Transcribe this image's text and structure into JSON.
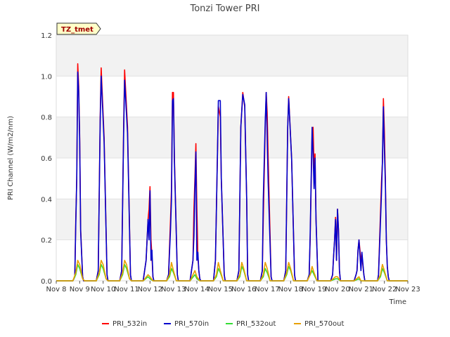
{
  "chart_data": {
    "type": "line",
    "title": "Tonzi Tower PRI",
    "xlabel": "Time",
    "ylabel": "PRI Channel (W/m2/nm)",
    "site_badge": "TZ_tmet",
    "ylim": [
      0,
      1.2
    ],
    "yticks": [
      0.0,
      0.2,
      0.4,
      0.6,
      0.8,
      1.0,
      1.2
    ],
    "ytick_labels": [
      "0.0",
      "0.2",
      "0.4",
      "0.6",
      "0.8",
      "1.0",
      "1.2"
    ],
    "xlim": [
      "2016-11-08",
      "2016-11-23"
    ],
    "xtick_labels": [
      "Nov 8",
      "Nov 9",
      "Nov 10",
      "Nov 11",
      "Nov 12",
      "Nov 13",
      "Nov 14",
      "Nov 15",
      "Nov 16",
      "Nov 17",
      "Nov 18",
      "Nov 19",
      "Nov 20",
      "Nov 21",
      "Nov 22",
      "Nov 23"
    ],
    "grid": "horizontal bands",
    "legend_position": "bottom",
    "series": [
      {
        "name": "PRI_532in",
        "color": "#ff0000",
        "x": [
          "2016-11-08 00:00",
          "2016-11-08 17:00",
          "2016-11-08 19:00",
          "2016-11-08 20:00",
          "2016-11-08 21:00",
          "2016-11-08 22:00",
          "2016-11-08 23:00",
          "2016-11-09 00:00",
          "2016-11-09 01:00",
          "2016-11-09 03:00",
          "2016-11-09 04:00",
          "2016-11-09 05:00",
          "2016-11-09 17:00",
          "2016-11-09 19:00",
          "2016-11-09 21:00",
          "2016-11-09 22:00",
          "2016-11-10 01:00",
          "2016-11-10 04:00",
          "2016-11-10 05:00",
          "2016-11-10 17:00",
          "2016-11-10 19:00",
          "2016-11-10 21:00",
          "2016-11-10 22:00",
          "2016-11-11 01:00",
          "2016-11-11 04:00",
          "2016-11-11 05:00",
          "2016-11-11 17:00",
          "2016-11-11 20:00",
          "2016-11-11 21:00",
          "2016-11-11 22:00",
          "2016-11-11 23:00",
          "2016-11-12 00:00",
          "2016-11-12 01:00",
          "2016-11-12 02:00",
          "2016-11-12 03:00",
          "2016-11-12 04:00",
          "2016-11-12 17:00",
          "2016-11-12 19:00",
          "2016-11-12 21:00",
          "2016-11-12 22:00",
          "2016-11-12 23:00",
          "2016-11-13 00:00",
          "2016-11-13 01:00",
          "2016-11-13 04:00",
          "2016-11-13 05:00",
          "2016-11-13 17:00",
          "2016-11-13 20:00",
          "2016-11-13 21:00",
          "2016-11-13 22:00",
          "2016-11-13 23:00",
          "2016-11-14 00:00",
          "2016-11-14 01:00",
          "2016-11-14 02:00",
          "2016-11-14 03:00",
          "2016-11-14 04:00",
          "2016-11-14 17:00",
          "2016-11-14 19:00",
          "2016-11-14 21:00",
          "2016-11-14 22:00",
          "2016-11-15 00:00",
          "2016-11-15 01:00",
          "2016-11-15 04:00",
          "2016-11-15 05:00",
          "2016-11-15 17:00",
          "2016-11-15 19:00",
          "2016-11-15 21:00",
          "2016-11-15 23:00",
          "2016-11-16 01:00",
          "2016-11-16 03:00",
          "2016-11-16 04:00",
          "2016-11-16 05:00",
          "2016-11-16 17:00",
          "2016-11-16 19:00",
          "2016-11-16 20:00",
          "2016-11-16 22:00",
          "2016-11-16 23:00",
          "2016-11-17 00:00",
          "2016-11-17 01:00",
          "2016-11-17 04:00",
          "2016-11-17 05:00",
          "2016-11-17 17:00",
          "2016-11-17 19:00",
          "2016-11-17 21:00",
          "2016-11-17 22:00",
          "2016-11-18 01:00",
          "2016-11-18 04:00",
          "2016-11-18 05:00",
          "2016-11-18 17:00",
          "2016-11-18 19:00",
          "2016-11-18 20:00",
          "2016-11-18 22:00",
          "2016-11-18 23:00",
          "2016-11-19 00:00",
          "2016-11-19 01:00",
          "2016-11-19 02:00",
          "2016-11-19 04:00",
          "2016-11-19 17:00",
          "2016-11-19 19:00",
          "2016-11-19 20:00",
          "2016-11-19 21:00",
          "2016-11-19 22:00",
          "2016-11-19 23:00",
          "2016-11-20 00:00",
          "2016-11-20 01:00",
          "2016-11-20 02:00",
          "2016-11-20 03:00",
          "2016-11-20 17:00",
          "2016-11-20 19:00",
          "2016-11-20 20:00",
          "2016-11-20 21:00",
          "2016-11-20 22:00",
          "2016-11-21 00:00",
          "2016-11-21 01:00",
          "2016-11-21 03:00",
          "2016-11-21 04:00",
          "2016-11-21 17:00",
          "2016-11-21 18:00",
          "2016-11-21 21:00",
          "2016-11-21 22:00",
          "2016-11-21 23:00",
          "2016-11-22 00:00",
          "2016-11-22 01:00",
          "2016-11-22 02:00",
          "2016-11-22 03:00",
          "2016-11-22 04:00",
          "2016-11-22 05:00",
          "2016-11-23 00:00"
        ],
        "y": [
          0,
          0,
          0.02,
          0.3,
          0.5,
          1.06,
          0.95,
          0.7,
          0.25,
          0.02,
          0,
          0,
          0,
          0.05,
          0.8,
          1.04,
          0.7,
          0.03,
          0,
          0,
          0.05,
          0.75,
          1.03,
          0.75,
          0.03,
          0,
          0,
          0.1,
          0.2,
          0.3,
          0.35,
          0.46,
          0.2,
          0.12,
          0.02,
          0,
          0,
          0.03,
          0.3,
          0.45,
          0.92,
          0.92,
          0.6,
          0.03,
          0,
          0,
          0.1,
          0.35,
          0.5,
          0.67,
          0.35,
          0.12,
          0.05,
          0.01,
          0,
          0,
          0.1,
          0.6,
          0.85,
          0.8,
          0.5,
          0.03,
          0,
          0,
          0.05,
          0.75,
          0.92,
          0.85,
          0.4,
          0.03,
          0,
          0,
          0.05,
          0.3,
          0.75,
          0.92,
          0.82,
          0.6,
          0.02,
          0,
          0,
          0.05,
          0.75,
          0.9,
          0.6,
          0.03,
          0,
          0,
          0.03,
          0.2,
          0.72,
          0.75,
          0.55,
          0.62,
          0.3,
          0,
          0,
          0.03,
          0.12,
          0.2,
          0.31,
          0.1,
          0.35,
          0.25,
          0.05,
          0,
          0,
          0.03,
          0.05,
          0.15,
          0.2,
          0.1,
          0.12,
          0.03,
          0,
          0,
          0.03,
          0.48,
          0.58,
          0.89,
          0.73,
          0.5,
          0.2,
          0.07,
          0.02,
          0,
          0
        ]
      },
      {
        "name": "PRI_570in",
        "color": "#0000cc",
        "x": [
          "2016-11-08 00:00",
          "2016-11-08 17:00",
          "2016-11-08 19:00",
          "2016-11-08 20:00",
          "2016-11-08 21:00",
          "2016-11-08 22:00",
          "2016-11-08 23:00",
          "2016-11-09 00:00",
          "2016-11-09 01:00",
          "2016-11-09 03:00",
          "2016-11-09 04:00",
          "2016-11-09 05:00",
          "2016-11-09 17:00",
          "2016-11-09 19:00",
          "2016-11-09 21:00",
          "2016-11-09 22:00",
          "2016-11-10 01:00",
          "2016-11-10 04:00",
          "2016-11-10 05:00",
          "2016-11-10 17:00",
          "2016-11-10 19:00",
          "2016-11-10 21:00",
          "2016-11-10 22:00",
          "2016-11-11 01:00",
          "2016-11-11 04:00",
          "2016-11-11 05:00",
          "2016-11-11 17:00",
          "2016-11-11 20:00",
          "2016-11-11 21:00",
          "2016-11-11 22:00",
          "2016-11-11 23:00",
          "2016-11-12 00:00",
          "2016-11-12 01:00",
          "2016-11-12 02:00",
          "2016-11-12 03:00",
          "2016-11-12 04:00",
          "2016-11-12 17:00",
          "2016-11-12 19:00",
          "2016-11-12 21:00",
          "2016-11-12 22:00",
          "2016-11-12 23:00",
          "2016-11-13 00:00",
          "2016-11-13 01:00",
          "2016-11-13 04:00",
          "2016-11-13 05:00",
          "2016-11-13 17:00",
          "2016-11-13 20:00",
          "2016-11-13 21:00",
          "2016-11-13 22:00",
          "2016-11-13 23:00",
          "2016-11-14 00:00",
          "2016-11-14 01:00",
          "2016-11-14 02:00",
          "2016-11-14 03:00",
          "2016-11-14 04:00",
          "2016-11-14 17:00",
          "2016-11-14 19:00",
          "2016-11-14 21:00",
          "2016-11-14 22:00",
          "2016-11-15 00:00",
          "2016-11-15 01:00",
          "2016-11-15 04:00",
          "2016-11-15 05:00",
          "2016-11-15 17:00",
          "2016-11-15 19:00",
          "2016-11-15 21:00",
          "2016-11-15 23:00",
          "2016-11-16 01:00",
          "2016-11-16 03:00",
          "2016-11-16 04:00",
          "2016-11-16 05:00",
          "2016-11-16 17:00",
          "2016-11-16 19:00",
          "2016-11-16 20:00",
          "2016-11-16 22:00",
          "2016-11-16 23:00",
          "2016-11-17 00:00",
          "2016-11-17 01:00",
          "2016-11-17 04:00",
          "2016-11-17 05:00",
          "2016-11-17 17:00",
          "2016-11-17 19:00",
          "2016-11-17 21:00",
          "2016-11-17 22:00",
          "2016-11-18 01:00",
          "2016-11-18 04:00",
          "2016-11-18 05:00",
          "2016-11-18 17:00",
          "2016-11-18 19:00",
          "2016-11-18 20:00",
          "2016-11-18 22:00",
          "2016-11-18 23:00",
          "2016-11-19 00:00",
          "2016-11-19 01:00",
          "2016-11-19 02:00",
          "2016-11-19 04:00",
          "2016-11-19 17:00",
          "2016-11-19 19:00",
          "2016-11-19 20:00",
          "2016-11-19 21:00",
          "2016-11-19 22:00",
          "2016-11-19 23:00",
          "2016-11-20 00:00",
          "2016-11-20 01:00",
          "2016-11-20 02:00",
          "2016-11-20 03:00",
          "2016-11-20 17:00",
          "2016-11-20 19:00",
          "2016-11-20 20:00",
          "2016-11-20 21:00",
          "2016-11-20 22:00",
          "2016-11-21 00:00",
          "2016-11-21 01:00",
          "2016-11-21 03:00",
          "2016-11-21 04:00",
          "2016-11-21 17:00",
          "2016-11-21 18:00",
          "2016-11-21 21:00",
          "2016-11-21 22:00",
          "2016-11-21 23:00",
          "2016-11-22 00:00",
          "2016-11-22 01:00",
          "2016-11-22 02:00",
          "2016-11-22 03:00",
          "2016-11-22 04:00",
          "2016-11-22 05:00",
          "2016-11-23 00:00"
        ],
        "y": [
          0,
          0,
          0.02,
          0.28,
          0.5,
          1.02,
          0.92,
          0.68,
          0.24,
          0.02,
          0,
          0,
          0,
          0.05,
          0.78,
          1.0,
          0.68,
          0.03,
          0,
          0,
          0.05,
          0.72,
          0.98,
          0.72,
          0.03,
          0,
          0,
          0.1,
          0.2,
          0.3,
          0.2,
          0.44,
          0.1,
          0.15,
          0.02,
          0,
          0,
          0.03,
          0.25,
          0.4,
          0.88,
          0.89,
          0.58,
          0.03,
          0,
          0,
          0.1,
          0.22,
          0.45,
          0.63,
          0.1,
          0.14,
          0.05,
          0.01,
          0,
          0,
          0.1,
          0.6,
          0.88,
          0.88,
          0.5,
          0.03,
          0,
          0,
          0.05,
          0.75,
          0.91,
          0.86,
          0.4,
          0.03,
          0,
          0,
          0.05,
          0.4,
          0.78,
          0.92,
          0.7,
          0.48,
          0.02,
          0,
          0,
          0.05,
          0.75,
          0.89,
          0.6,
          0.03,
          0,
          0,
          0.03,
          0.22,
          0.75,
          0.62,
          0.45,
          0.6,
          0.3,
          0,
          0,
          0.03,
          0.12,
          0.2,
          0.3,
          0.1,
          0.35,
          0.25,
          0.05,
          0,
          0,
          0.03,
          0.05,
          0.15,
          0.2,
          0.05,
          0.14,
          0.03,
          0,
          0,
          0.03,
          0.42,
          0.58,
          0.85,
          0.64,
          0.48,
          0.2,
          0.07,
          0.02,
          0,
          0
        ]
      },
      {
        "name": "PRI_532out",
        "color": "#33dd33",
        "x": [
          "2016-11-08 00:00",
          "2016-11-08 17:00",
          "2016-11-08 20:00",
          "2016-11-08 22:00",
          "2016-11-09 00:00",
          "2016-11-09 03:00",
          "2016-11-09 05:00",
          "2016-11-09 17:00",
          "2016-11-09 20:00",
          "2016-11-09 22:00",
          "2016-11-10 00:00",
          "2016-11-10 03:00",
          "2016-11-10 05:00",
          "2016-11-10 17:00",
          "2016-11-10 20:00",
          "2016-11-10 22:00",
          "2016-11-11 00:00",
          "2016-11-11 03:00",
          "2016-11-11 05:00",
          "2016-11-11 17:00",
          "2016-11-11 22:00",
          "2016-11-12 00:00",
          "2016-11-12 03:00",
          "2016-11-12 17:00",
          "2016-11-12 20:00",
          "2016-11-12 22:00",
          "2016-11-13 00:00",
          "2016-11-13 03:00",
          "2016-11-13 17:00",
          "2016-11-13 22:00",
          "2016-11-14 00:00",
          "2016-11-14 03:00",
          "2016-11-14 17:00",
          "2016-11-14 20:00",
          "2016-11-14 22:00",
          "2016-11-15 00:00",
          "2016-11-15 03:00",
          "2016-11-15 17:00",
          "2016-11-15 20:00",
          "2016-11-15 22:00",
          "2016-11-16 00:00",
          "2016-11-16 03:00",
          "2016-11-16 17:00",
          "2016-11-16 20:00",
          "2016-11-16 22:00",
          "2016-11-17 00:00",
          "2016-11-17 03:00",
          "2016-11-17 17:00",
          "2016-11-17 20:00",
          "2016-11-17 22:00",
          "2016-11-18 00:00",
          "2016-11-18 03:00",
          "2016-11-18 17:00",
          "2016-11-18 20:00",
          "2016-11-18 22:00",
          "2016-11-19 00:00",
          "2016-11-19 03:00",
          "2016-11-19 17:00",
          "2016-11-19 22:00",
          "2016-11-20 00:00",
          "2016-11-20 03:00",
          "2016-11-20 17:00",
          "2016-11-20 22:00",
          "2016-11-21 00:00",
          "2016-11-21 03:00",
          "2016-11-21 17:00",
          "2016-11-21 20:00",
          "2016-11-21 22:00",
          "2016-11-22 00:00",
          "2016-11-22 03:00",
          "2016-11-23 00:00"
        ],
        "y": [
          0,
          0,
          0.03,
          0.08,
          0.06,
          0.01,
          0,
          0,
          0.03,
          0.08,
          0.06,
          0.01,
          0,
          0,
          0.03,
          0.08,
          0.06,
          0.01,
          0,
          0,
          0.02,
          0.01,
          0,
          0,
          0.02,
          0.06,
          0.04,
          0,
          0,
          0.03,
          0.01,
          0,
          0,
          0.02,
          0.06,
          0.04,
          0,
          0,
          0.02,
          0.07,
          0.05,
          0,
          0,
          0.02,
          0.06,
          0.04,
          0,
          0,
          0.03,
          0.07,
          0.05,
          0,
          0,
          0.03,
          0.05,
          0.03,
          0,
          0,
          0.01,
          0.01,
          0,
          0,
          0.01,
          0,
          0,
          0,
          0.02,
          0.06,
          0.04,
          0,
          0
        ]
      },
      {
        "name": "PRI_570out",
        "color": "#e8a000",
        "x": [
          "2016-11-08 00:00",
          "2016-11-08 17:00",
          "2016-11-08 20:00",
          "2016-11-08 22:00",
          "2016-11-09 00:00",
          "2016-11-09 03:00",
          "2016-11-09 05:00",
          "2016-11-09 17:00",
          "2016-11-09 20:00",
          "2016-11-09 22:00",
          "2016-11-10 00:00",
          "2016-11-10 03:00",
          "2016-11-10 05:00",
          "2016-11-10 17:00",
          "2016-11-10 20:00",
          "2016-11-10 22:00",
          "2016-11-11 00:00",
          "2016-11-11 03:00",
          "2016-11-11 05:00",
          "2016-11-11 17:00",
          "2016-11-11 22:00",
          "2016-11-12 00:00",
          "2016-11-12 03:00",
          "2016-11-12 17:00",
          "2016-11-12 20:00",
          "2016-11-12 22:00",
          "2016-11-13 00:00",
          "2016-11-13 03:00",
          "2016-11-13 17:00",
          "2016-11-13 22:00",
          "2016-11-14 00:00",
          "2016-11-14 03:00",
          "2016-11-14 17:00",
          "2016-11-14 20:00",
          "2016-11-14 22:00",
          "2016-11-15 00:00",
          "2016-11-15 03:00",
          "2016-11-15 17:00",
          "2016-11-15 20:00",
          "2016-11-15 22:00",
          "2016-11-16 00:00",
          "2016-11-16 03:00",
          "2016-11-16 17:00",
          "2016-11-16 20:00",
          "2016-11-16 22:00",
          "2016-11-17 00:00",
          "2016-11-17 03:00",
          "2016-11-17 17:00",
          "2016-11-17 20:00",
          "2016-11-17 22:00",
          "2016-11-18 00:00",
          "2016-11-18 03:00",
          "2016-11-18 17:00",
          "2016-11-18 20:00",
          "2016-11-18 22:00",
          "2016-11-19 00:00",
          "2016-11-19 03:00",
          "2016-11-19 17:00",
          "2016-11-19 22:00",
          "2016-11-20 00:00",
          "2016-11-20 03:00",
          "2016-11-20 17:00",
          "2016-11-20 22:00",
          "2016-11-21 00:00",
          "2016-11-21 03:00",
          "2016-11-21 17:00",
          "2016-11-21 20:00",
          "2016-11-21 22:00",
          "2016-11-22 00:00",
          "2016-11-22 03:00",
          "2016-11-23 00:00"
        ],
        "y": [
          0,
          0,
          0.04,
          0.1,
          0.08,
          0.01,
          0,
          0,
          0.04,
          0.1,
          0.08,
          0.01,
          0,
          0,
          0.04,
          0.1,
          0.08,
          0.01,
          0,
          0,
          0.03,
          0.02,
          0,
          0,
          0.03,
          0.09,
          0.05,
          0,
          0,
          0.05,
          0.02,
          0,
          0,
          0.03,
          0.09,
          0.05,
          0,
          0,
          0.03,
          0.09,
          0.06,
          0,
          0,
          0.03,
          0.09,
          0.06,
          0,
          0,
          0.04,
          0.09,
          0.06,
          0,
          0,
          0.03,
          0.07,
          0.04,
          0,
          0,
          0.02,
          0.02,
          0,
          0,
          0.02,
          0,
          0,
          0,
          0.03,
          0.08,
          0.05,
          0,
          0
        ]
      }
    ]
  }
}
